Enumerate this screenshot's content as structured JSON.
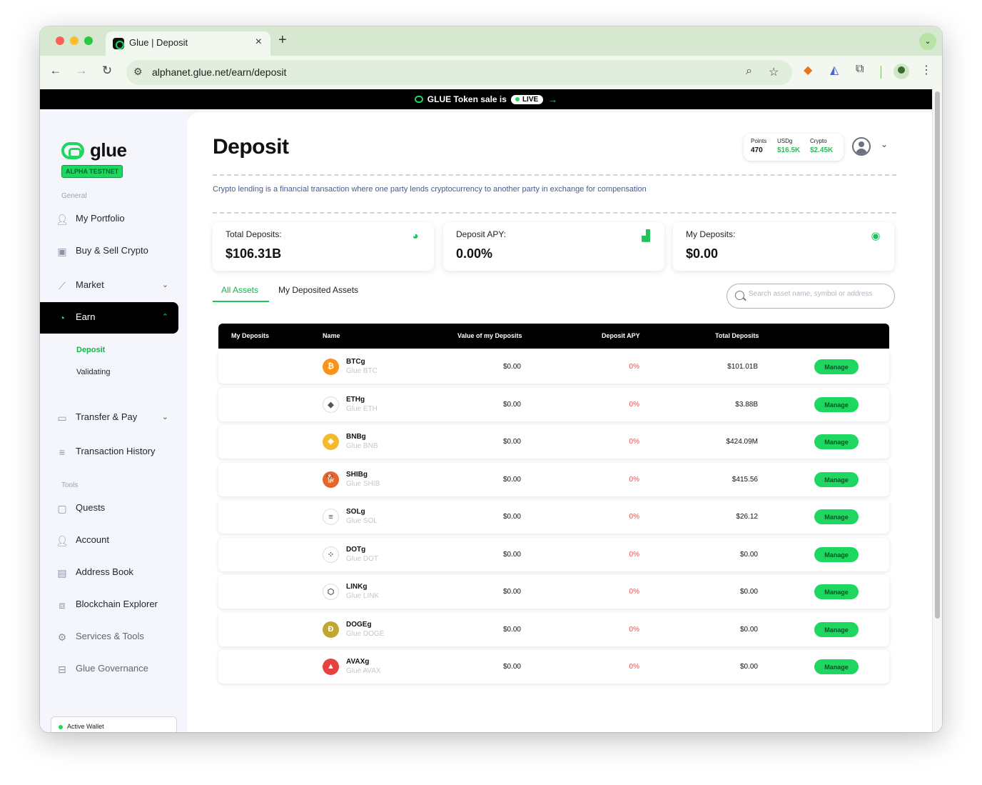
{
  "browser": {
    "tab_title": "Glue | Deposit",
    "url_host": "alphanet.glue.net",
    "url_path": "/earn/deposit",
    "new_tab": "+",
    "close": "×"
  },
  "banner": {
    "text": "GLUE Token sale is",
    "pill": "LIVE"
  },
  "sidebar": {
    "brand": "glue",
    "badge": "ALPHA TESTNET",
    "section_general": "General",
    "section_tools": "Tools",
    "items": [
      {
        "label": "My Portfolio"
      },
      {
        "label": "Buy & Sell Crypto"
      },
      {
        "label": "Market"
      },
      {
        "label": "Earn"
      },
      {
        "label": "Transfer & Pay"
      },
      {
        "label": "Transaction History"
      },
      {
        "label": "Quests"
      },
      {
        "label": "Account"
      },
      {
        "label": "Address Book"
      },
      {
        "label": "Blockchain Explorer"
      },
      {
        "label": "Services & Tools"
      },
      {
        "label": "Glue Governance"
      }
    ],
    "sub_items": [
      {
        "label": "Deposit"
      },
      {
        "label": "Validating"
      }
    ],
    "wallet": "Active Wallet"
  },
  "header": {
    "title": "Deposit",
    "stats": [
      {
        "label": "Points",
        "value": "470"
      },
      {
        "label": "USDg",
        "value": "$16.5K"
      },
      {
        "label": "Crypto",
        "value": "$2.45K"
      }
    ]
  },
  "description": "Crypto lending is a financial transaction where one party lends cryptocurrency to another party in exchange for compensation",
  "cards": [
    {
      "label": "Total Deposits:",
      "value": "$106.31B",
      "icon": "pie-chart-icon"
    },
    {
      "label": "Deposit APY:",
      "value": "0.00%",
      "icon": "bar-chart-icon"
    },
    {
      "label": "My Deposits:",
      "value": "$0.00",
      "icon": "coins-icon"
    }
  ],
  "tabs": [
    {
      "label": "All Assets"
    },
    {
      "label": "My Deposited Assets"
    }
  ],
  "search": {
    "placeholder": "Search asset name, symbol or address"
  },
  "table": {
    "headers": [
      "My Deposits",
      "Name",
      "Value of my Deposits",
      "Deposit APY",
      "Total Deposits"
    ],
    "manage_label": "Manage",
    "rows": [
      {
        "symbol": "BTCg",
        "name": "Glue BTC",
        "value": "$0.00",
        "apy": "0%",
        "total": "$101.01B",
        "glyph": "₿",
        "color": "#f7931a"
      },
      {
        "symbol": "ETHg",
        "name": "Glue ETH",
        "value": "$0.00",
        "apy": "0%",
        "total": "$3.88B",
        "glyph": "◆",
        "color": "#ffffff"
      },
      {
        "symbol": "BNBg",
        "name": "Glue BNB",
        "value": "$0.00",
        "apy": "0%",
        "total": "$424.09M",
        "glyph": "◈",
        "color": "#f3ba2f"
      },
      {
        "symbol": "SHIBg",
        "name": "Glue SHIB",
        "value": "$0.00",
        "apy": "0%",
        "total": "$415.56",
        "glyph": "🐕",
        "color": "#e8642a"
      },
      {
        "symbol": "SOLg",
        "name": "Glue SOL",
        "value": "$0.00",
        "apy": "0%",
        "total": "$26.12",
        "glyph": "≡",
        "color": "#ffffff"
      },
      {
        "symbol": "DOTg",
        "name": "Glue DOT",
        "value": "$0.00",
        "apy": "0%",
        "total": "$0.00",
        "glyph": "⁘",
        "color": "#ffffff"
      },
      {
        "symbol": "LINKg",
        "name": "Glue LINK",
        "value": "$0.00",
        "apy": "0%",
        "total": "$0.00",
        "glyph": "⬡",
        "color": "#ffffff"
      },
      {
        "symbol": "DOGEg",
        "name": "Glue DOGE",
        "value": "$0.00",
        "apy": "0%",
        "total": "$0.00",
        "glyph": "Ð",
        "color": "#c2a633"
      },
      {
        "symbol": "AVAXg",
        "name": "Glue AVAX",
        "value": "$0.00",
        "apy": "0%",
        "total": "$0.00",
        "glyph": "▲",
        "color": "#e84142"
      }
    ]
  }
}
